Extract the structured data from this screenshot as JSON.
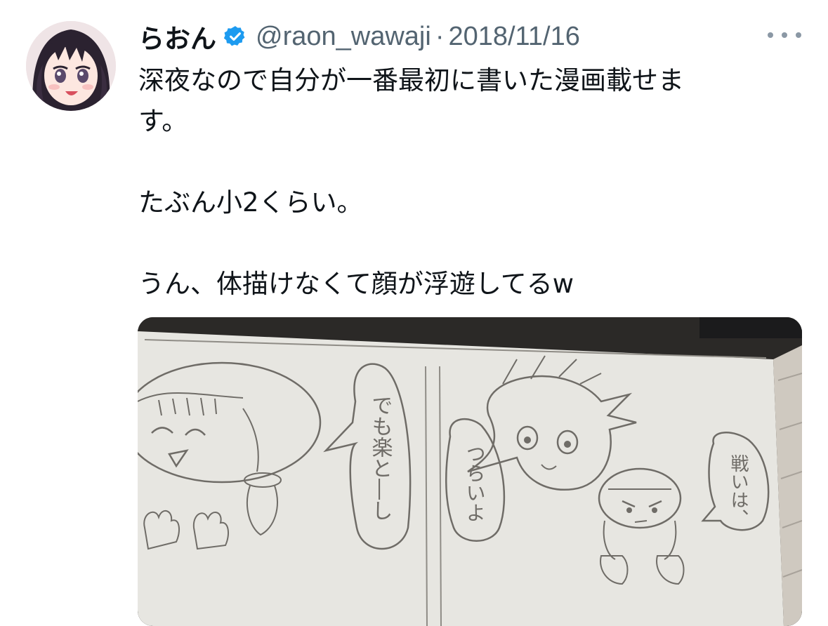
{
  "tweet": {
    "author": {
      "display_name": "らおん",
      "handle": "@raon_wawaji",
      "verified": true
    },
    "separator": "·",
    "date": "2018/11/16",
    "text_lines": [
      "深夜なので自分が一番最初に書いた漫画載せま",
      "す。",
      "",
      "たぶん小2くらい。",
      "",
      "うん、体描けなくて顔が浮遊してるw"
    ],
    "icons": {
      "verified": "verified-badge-icon",
      "more": "more-options-icon"
    },
    "colors": {
      "text": "#0f1419",
      "secondary": "#536471",
      "verified": "#1d9bf0"
    },
    "media": {
      "panel_left_bubble": "でも楽と―し",
      "panel_mid_bubble": "つらいよ",
      "panel_right_bubble": "戦いは、"
    }
  }
}
